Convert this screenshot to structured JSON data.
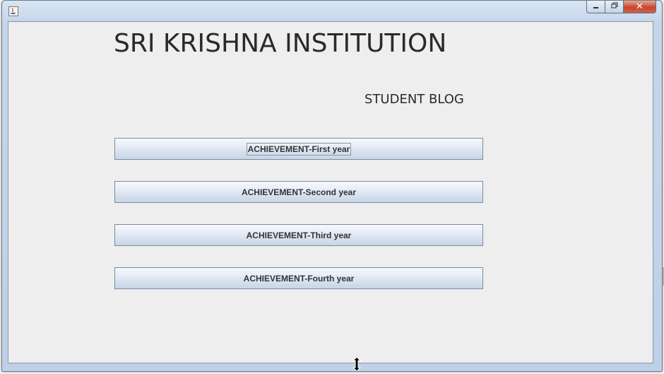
{
  "window": {
    "controls": {
      "minimize_icon": "minimize-icon",
      "maximize_icon": "restore-icon",
      "close_icon": "close-icon",
      "close_glyph": "✕"
    }
  },
  "main": {
    "heading": "SRI KRISHNA INSTITUTION",
    "subheading": "STUDENT BLOG",
    "buttons": [
      {
        "label": "ACHIEVEMENT-First year"
      },
      {
        "label": "ACHIEVEMENT-Second year"
      },
      {
        "label": "ACHIEVEMENT-Third year"
      },
      {
        "label": "ACHIEVEMENT-Fourth year"
      }
    ]
  },
  "colors": {
    "client_background": "#eeeeee",
    "button_border": "#7a8aa0",
    "close_button": "#c7462c"
  }
}
